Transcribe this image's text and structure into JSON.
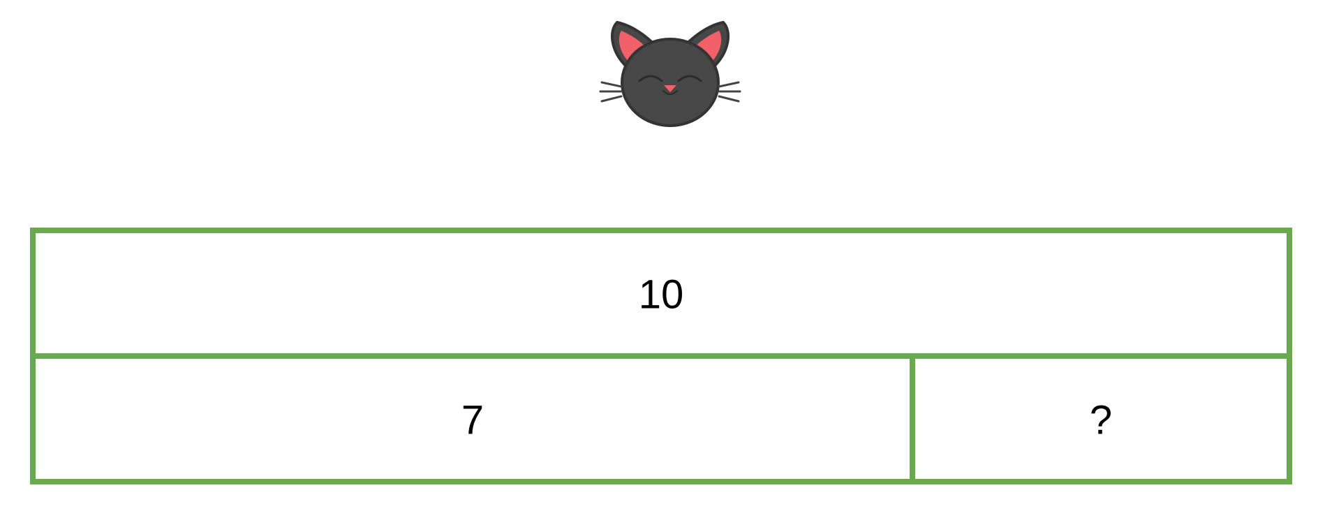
{
  "colors": {
    "bar_border": "#6aaa4f",
    "cat_face": "#474747",
    "cat_outline": "#333333",
    "cat_ear_inner": "#f2606a",
    "cat_nose": "#f2606a",
    "text": "#000000"
  },
  "icon": "cat-face-icon",
  "bar_model": {
    "whole": "10",
    "part_known": "7",
    "part_unknown": "?",
    "part_known_fraction": 0.7
  }
}
